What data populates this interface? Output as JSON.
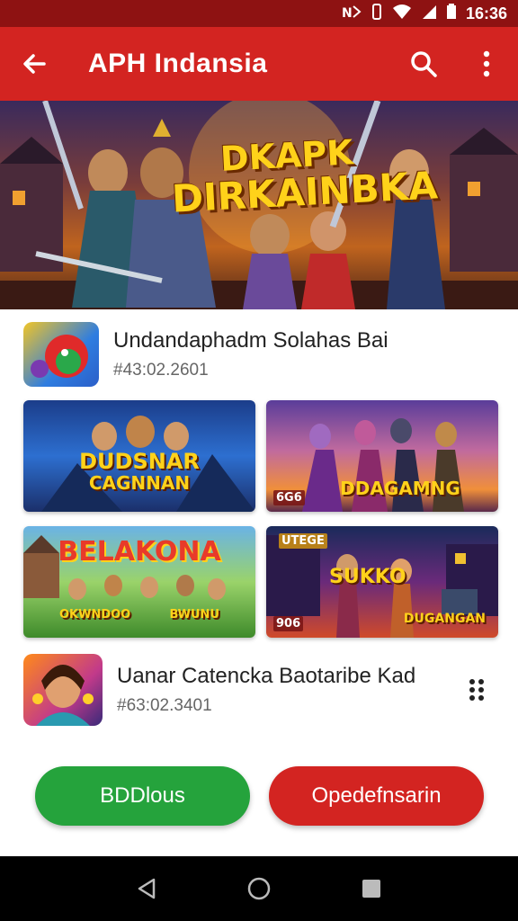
{
  "status_bar": {
    "time": "16:36",
    "icons": [
      "nfc-icon",
      "vibrate-icon",
      "wifi-icon",
      "signal-icon",
      "battery-icon"
    ]
  },
  "app_bar": {
    "title": "APH Indansia",
    "back_icon": "arrow-back-icon",
    "search_icon": "search-icon",
    "menu_icon": "more-vert-icon",
    "color": "#d32421"
  },
  "hero": {
    "title_line1": "DKAPK",
    "title_line2": "DIRKAINBKA"
  },
  "featured_app": {
    "name": "Undandaphadm Solahas Bai",
    "id": "#43:02.2601"
  },
  "game_tiles": [
    {
      "label_line1": "DUDSNAR",
      "label_line2": "CAGNNAN"
    },
    {
      "label": "DDAGAMNG",
      "badge": "6G6"
    },
    {
      "label": "BELAKONA",
      "sub_left": "OKWNDOO",
      "sub_right": "BWUNU"
    },
    {
      "label": "SUKKO",
      "sub": "DUGANGAN",
      "badge_top": "UTEGE",
      "badge_bottom": "906"
    }
  ],
  "second_app": {
    "name": "Uanar Catencka Baotaribe Kad",
    "id": "#63:02.3401",
    "more_icon": "grid-dots-icon"
  },
  "buttons": {
    "primary_label": "BDDlous",
    "primary_color": "#25a33c",
    "secondary_label": "Opedefnsarin",
    "secondary_color": "#d32421"
  },
  "nav_bar": {
    "back_icon": "nav-back-icon",
    "home_icon": "nav-home-icon",
    "recents_icon": "nav-recents-icon"
  }
}
